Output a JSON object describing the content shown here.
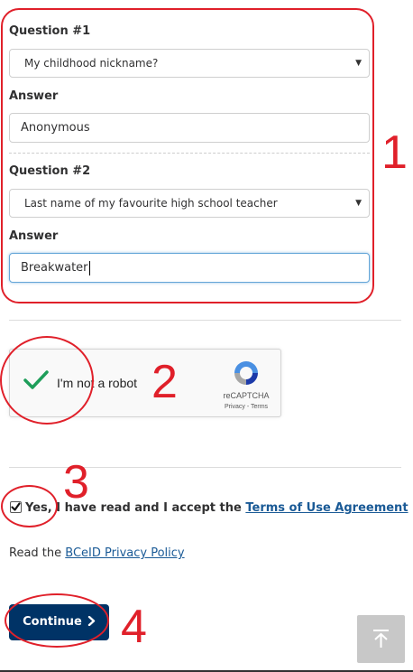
{
  "form": {
    "question1": {
      "label": "Question #1",
      "selected": "My childhood nickname?",
      "answer_label": "Answer",
      "answer_value": "Anonymous"
    },
    "question2": {
      "label": "Question #2",
      "selected": "Last name of my favourite high school teacher",
      "answer_label": "Answer",
      "answer_value": "Breakwater"
    },
    "dropdown_icon": "caret-down-icon"
  },
  "captcha": {
    "label": "I'm not a robot",
    "brand": "reCAPTCHA",
    "links": "Privacy - Terms",
    "checked": true,
    "check_icon": "checkmark-icon",
    "logo_icon": "recaptcha-logo-icon"
  },
  "terms": {
    "checked": true,
    "text": "Yes, I have read and I accept the ",
    "link_text": "Terms of Use Agreement"
  },
  "privacy": {
    "text": "Read the ",
    "link_text": "BCeID Privacy Policy"
  },
  "buttons": {
    "continue_label": "Continue",
    "continue_icon": "chevron-right-icon",
    "back_to_top_icon": "arrow-up-icon"
  },
  "annotations": {
    "color": "#e0202a",
    "labels": [
      "1",
      "2",
      "3",
      "4"
    ]
  },
  "colors": {
    "primary_button": "#003366",
    "link": "#1a5a96",
    "focus_border": "#64a6d8",
    "recaptcha_check": "#1e9e5a"
  }
}
